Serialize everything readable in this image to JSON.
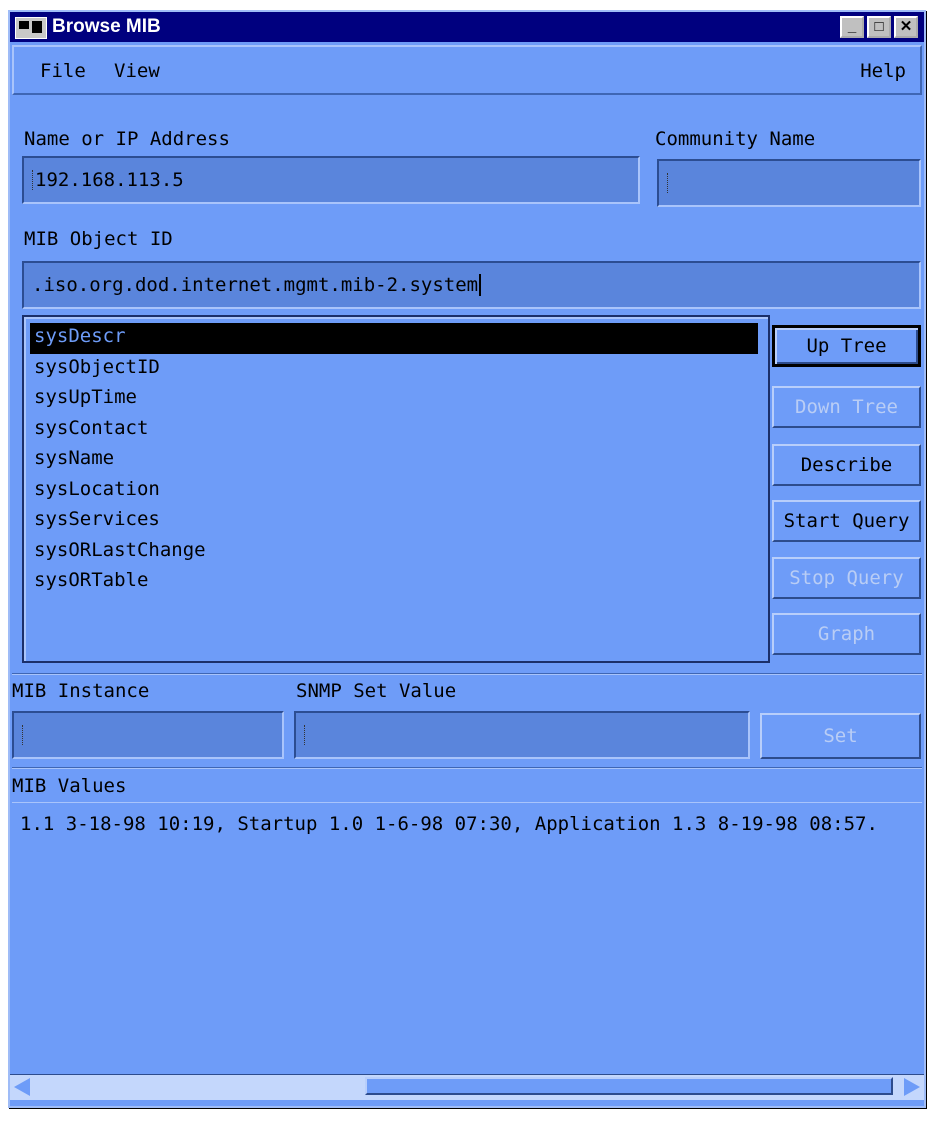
{
  "window": {
    "title": "Browse MIB"
  },
  "menu": {
    "file": "File",
    "view": "View",
    "help": "Help"
  },
  "fields": {
    "name_label": "Name or IP Address",
    "name_value": "192.168.113.5",
    "community_label": "Community Name",
    "community_value": "",
    "oid_label": "MIB Object ID",
    "oid_value": ".iso.org.dod.internet.mgmt.mib-2.system",
    "instance_label": "MIB Instance",
    "instance_value": "",
    "setvalue_label": "SNMP Set Value",
    "setvalue_value": ""
  },
  "list": {
    "items": [
      "sysDescr",
      "sysObjectID",
      "sysUpTime",
      "sysContact",
      "sysName",
      "sysLocation",
      "sysServices",
      "sysORLastChange",
      "sysORTable"
    ],
    "selected_index": 0
  },
  "buttons": {
    "up_tree": "Up Tree",
    "down_tree": "Down Tree",
    "describe": "Describe",
    "start_query": "Start Query",
    "stop_query": "Stop Query",
    "graph": "Graph",
    "set": "Set"
  },
  "values": {
    "label": "MIB Values",
    "text": "1.1 3-18-98 10:19, Startup 1.0 1-6-98 07:30, Application 1.3 8-19-98 08:57."
  },
  "colors": {
    "background": "#6e9cf8",
    "titlebar": "#00007f",
    "field": "#5a85dc"
  }
}
